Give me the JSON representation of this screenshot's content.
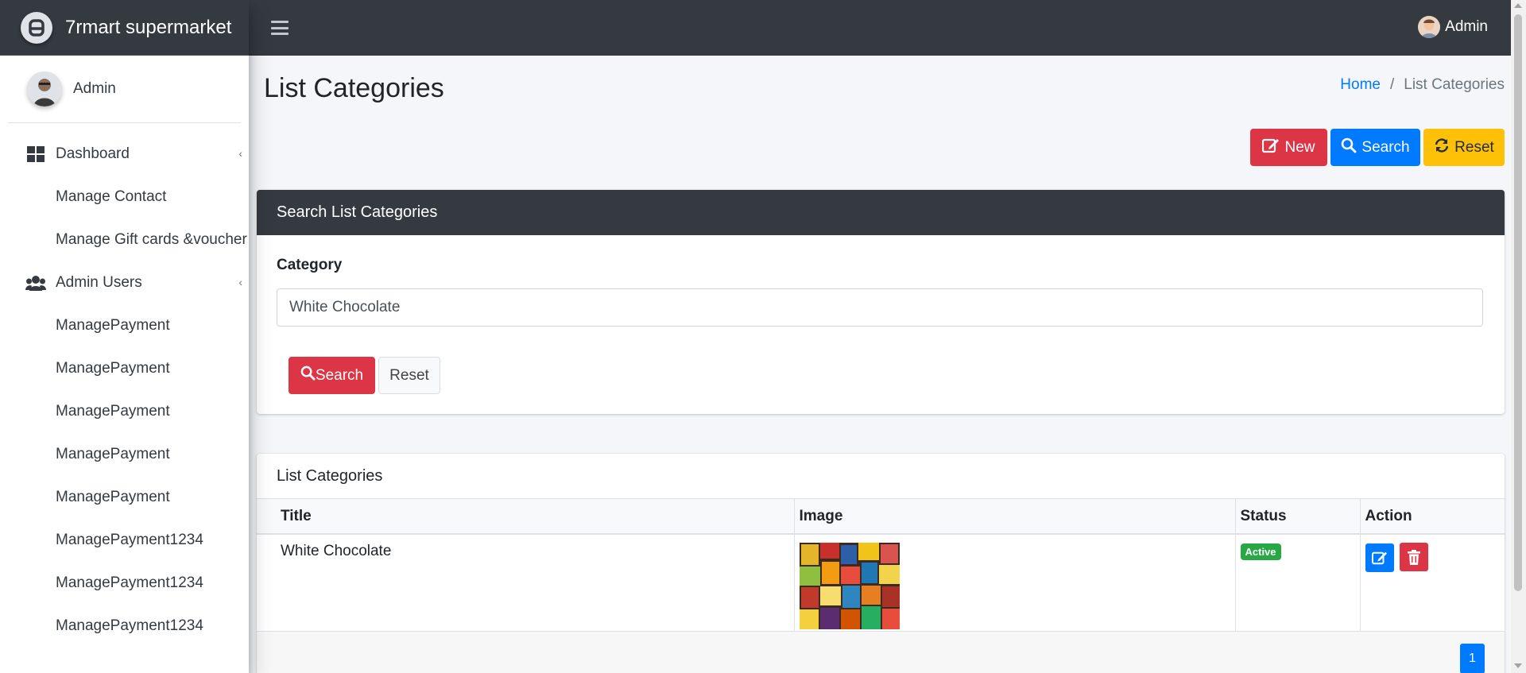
{
  "brand": {
    "title": "7rmart supermarket"
  },
  "topbar": {
    "user_label": "Admin"
  },
  "sidebar": {
    "user_name": "Admin",
    "items": [
      {
        "label": "Dashboard",
        "icon": "dashboard-icon",
        "type": "parent"
      },
      {
        "label": "Manage Contact",
        "type": "sub"
      },
      {
        "label": "Manage Gift cards &voucher",
        "type": "sub"
      },
      {
        "label": "Admin Users",
        "icon": "users-icon",
        "type": "parent"
      },
      {
        "label": "ManagePayment",
        "type": "sub"
      },
      {
        "label": "ManagePayment",
        "type": "sub"
      },
      {
        "label": "ManagePayment",
        "type": "sub"
      },
      {
        "label": "ManagePayment",
        "type": "sub"
      },
      {
        "label": "ManagePayment",
        "type": "sub"
      },
      {
        "label": "ManagePayment1234",
        "type": "sub"
      },
      {
        "label": "ManagePayment1234",
        "type": "sub"
      },
      {
        "label": "ManagePayment1234",
        "type": "sub"
      }
    ]
  },
  "page": {
    "title": "List Categories",
    "breadcrumb": {
      "home": "Home",
      "separator": "/",
      "current": "List Categories"
    }
  },
  "actions": {
    "new_label": "New",
    "search_label": "Search",
    "reset_label": "Reset"
  },
  "search_card": {
    "title": "Search List Categories",
    "category_label": "Category",
    "category_value": "White Chocolate",
    "search_button": "Search",
    "reset_button": "Reset"
  },
  "list_card": {
    "title": "List Categories",
    "columns": [
      "Title",
      "Image",
      "Status",
      "Action"
    ],
    "rows": [
      {
        "title": "White Chocolate",
        "status": "Active"
      }
    ],
    "pagination": {
      "current": "1"
    }
  },
  "colors": {
    "danger": "#dc3545",
    "primary": "#007bff",
    "warning": "#ffc107",
    "success": "#28a745",
    "dark": "#343a40"
  }
}
